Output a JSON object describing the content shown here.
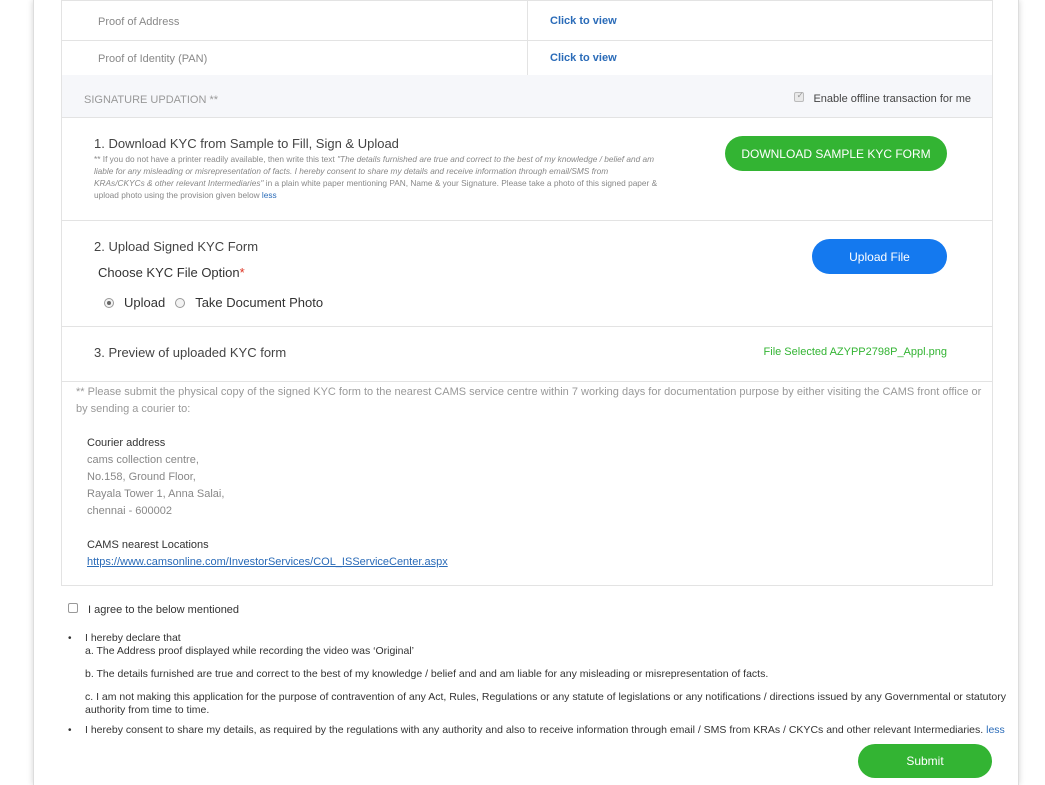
{
  "documents": [
    {
      "label": "Proof of Address",
      "link": "Click to view"
    },
    {
      "label": "Proof of Identity (PAN)",
      "link": "Click to view"
    }
  ],
  "signature": {
    "title": "SIGNATURE UPDATION **",
    "offline_label": "Enable offline transaction for me",
    "offline_checked": true
  },
  "step1": {
    "title": "1. Download KYC from Sample to Fill, Sign & Upload",
    "note_prefix": "** If you do not have a printer readily available, then write this text ",
    "note_quote": "\"The details furnished are true and correct to the best of my knowledge / belief and am liable for any misleading or misrepresentation of facts. I hereby consent to share my details and receive information through email/SMS from KRAs/CKYCs & other relevant Intermediaries\"",
    "note_suffix": " in a plain white paper mentioning PAN, Name & your Signature. Please take a photo of this signed paper & upload photo using the provision given below ",
    "note_link": "less",
    "button": "DOWNLOAD SAMPLE KYC FORM"
  },
  "step2": {
    "title": "2. Upload Signed KYC Form",
    "option_label": "Choose KYC File Option",
    "required_mark": "*",
    "options": [
      "Upload",
      "Take Document Photo"
    ],
    "selected": "Upload",
    "button": "Upload File"
  },
  "step3": {
    "title": "3. Preview of uploaded KYC form",
    "file_selected": "File Selected AZYPP2798P_Appl.png"
  },
  "submission_note": "** Please submit the physical copy of the signed KYC form to the nearest CAMS service centre within 7 working days for documentation purpose by either visiting the CAMS front office or by sending a courier to:",
  "courier": {
    "heading": "Courier address",
    "lines": [
      "cams collection centre,",
      "No.158, Ground Floor,",
      "Rayala Tower 1, Anna Salai,",
      "chennai - 600002"
    ],
    "locations_heading": "CAMS nearest Locations",
    "locations_url": "https://www.camsonline.com/InvestorServices/COL_ISServiceCenter.aspx"
  },
  "agreement": {
    "label": "I agree to the below mentioned",
    "checked": false,
    "declare_intro": "I hereby declare that",
    "points": [
      "a. The Address proof displayed while recording the video was ‘Original’",
      "b. The details furnished are true and correct to the best of my knowledge / belief and and am liable for any misleading or misrepresentation of facts.",
      "c. I am not making this application for the purpose of contravention of any Act, Rules, Regulations or any statute of legislations or any notifications / directions issued by any Governmental or statutory authority from time to time."
    ],
    "consent": "I hereby consent to share my details, as required by the regulations with any authority and also to receive information through email / SMS from KRAs / CKYCs and other relevant Intermediaries.",
    "consent_link": "less"
  },
  "submit_label": "Submit",
  "colors": {
    "green": "#33b433",
    "blue": "#1479ef",
    "link": "#2a6bb8"
  }
}
